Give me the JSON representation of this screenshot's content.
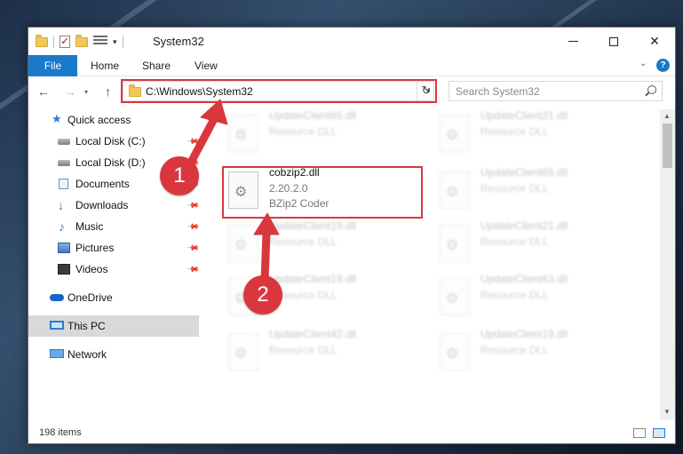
{
  "window": {
    "title": "System32",
    "minimize_glyph": "",
    "maximize_glyph": "",
    "close_glyph": "✕"
  },
  "ribbon": {
    "tabs": [
      "File",
      "Home",
      "Share",
      "View"
    ],
    "help_glyph": "?"
  },
  "navigation": {
    "address_path": "C:\\Windows\\System32",
    "search_placeholder": "Search System32"
  },
  "sidebar": {
    "items": [
      {
        "label": "Quick access",
        "icon": "star-icon"
      },
      {
        "label": "Local Disk (C:)",
        "icon": "drive-icon"
      },
      {
        "label": "Local Disk (D:)",
        "icon": "drive-icon"
      },
      {
        "label": "Documents",
        "icon": "documents-icon"
      },
      {
        "label": "Downloads",
        "icon": "downloads-icon"
      },
      {
        "label": "Music",
        "icon": "music-icon"
      },
      {
        "label": "Pictures",
        "icon": "pictures-icon"
      },
      {
        "label": "Videos",
        "icon": "videos-icon"
      },
      {
        "label": "OneDrive",
        "icon": "onedrive-icon"
      },
      {
        "label": "This PC",
        "icon": "this-pc-icon"
      },
      {
        "label": "Network",
        "icon": "network-icon"
      }
    ],
    "selected": "This PC"
  },
  "files": {
    "highlighted": {
      "name": "cobzip2.dll",
      "version": "2.20.2.0",
      "description": "BZip2 Coder"
    },
    "blurred": [
      {
        "name": "UpdateClient65.dll",
        "type": "Resource DLL"
      },
      {
        "name": "UpdateClient21.dll",
        "type": "Resource DLL"
      },
      {
        "name": "UpdateClient65.dll",
        "type": "Resource DLL"
      },
      {
        "name": "UpdateClient19.dll",
        "type": "Resource DLL"
      },
      {
        "name": "UpdateClient21.dll",
        "type": "Resource DLL"
      },
      {
        "name": "UpdateClient19.dll",
        "type": "Resource DLL"
      },
      {
        "name": "UpdateClient63.dll",
        "type": "Resource DLL"
      },
      {
        "name": "UpdateClient42.dll",
        "type": "Resource DLL"
      },
      {
        "name": "UpdateClient19.dll",
        "type": "Resource DLL"
      }
    ]
  },
  "status": {
    "item_count": "198 items"
  },
  "callouts": [
    "1",
    "2"
  ],
  "colors": {
    "accent": "#1979ca",
    "highlight": "#d9373d"
  }
}
